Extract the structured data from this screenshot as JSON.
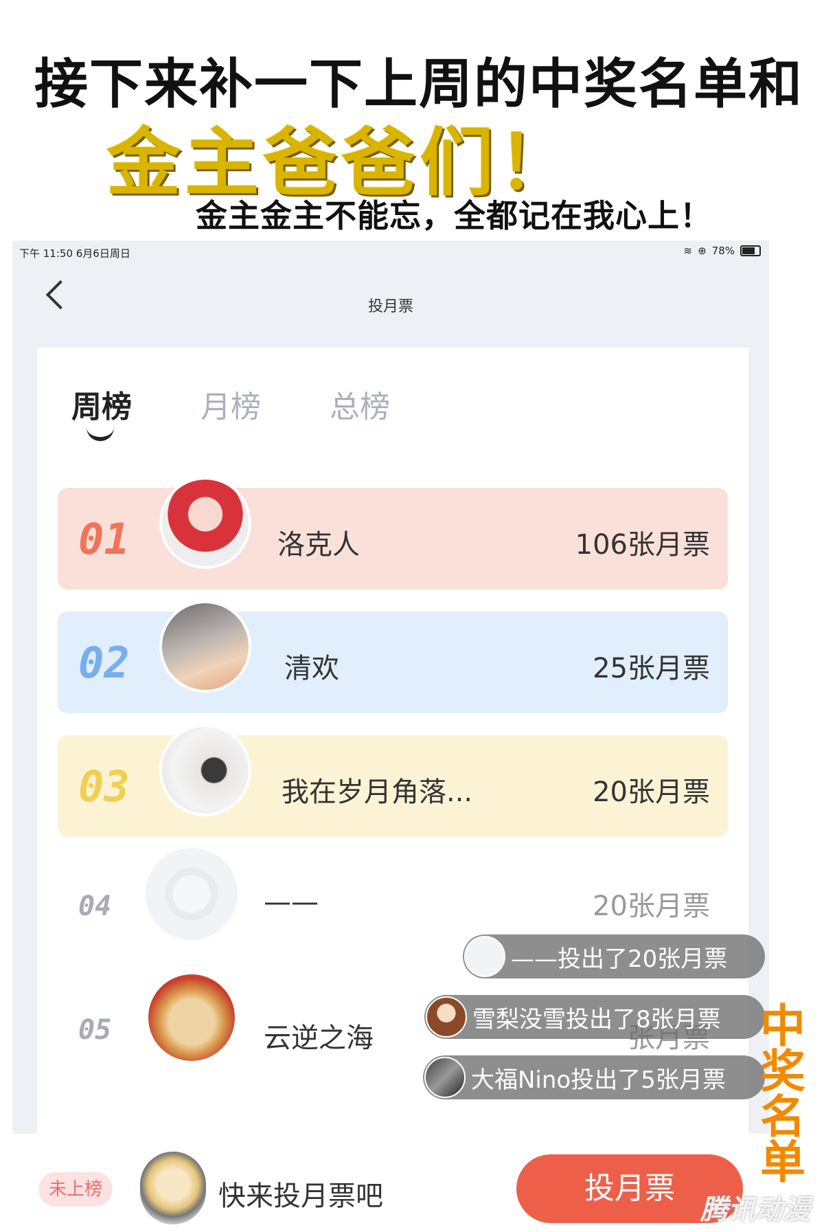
{
  "overlay": {
    "headline": "接下来补一下上周的中奖名单和",
    "gold_text": "金主爸爸们！",
    "sub_text": "金主金主不能忘，全都记在我心上！",
    "stamp": [
      "中",
      "奖",
      "名",
      "单"
    ],
    "watermark": "腾讯动漫"
  },
  "status_bar": {
    "time": "下午 11:50   6月6日周日",
    "battery": "78%"
  },
  "nav": {
    "title": "投月票"
  },
  "tabs": [
    {
      "label": "周榜"
    },
    {
      "label": "月榜"
    },
    {
      "label": "总榜"
    }
  ],
  "ranking": [
    {
      "rank": "01",
      "name": "洛克人",
      "votes": "106张月票"
    },
    {
      "rank": "02",
      "name": "清欢",
      "votes": "25张月票"
    },
    {
      "rank": "03",
      "name": "我在岁月角落...",
      "votes": "20张月票"
    },
    {
      "rank": "04",
      "name": "——",
      "votes": "20张月票"
    },
    {
      "rank": "05",
      "name": "云逆之海",
      "votes": "张月票"
    }
  ],
  "toasts": [
    "——投出了20张月票",
    "雪梨没雪投出了8张月票",
    "大福Nino投出了5张月票"
  ],
  "bottom": {
    "badge": "未上榜",
    "prompt": "快来投月票吧",
    "button": "投月票"
  },
  "colors": {
    "accent": "#ee5f4a",
    "row1": "#fae0d8",
    "row2": "#e1eefb",
    "row3": "#fcf3d5",
    "rank1": "#f0735a",
    "rank2": "#77aef0",
    "rank3": "#f1cf55"
  }
}
